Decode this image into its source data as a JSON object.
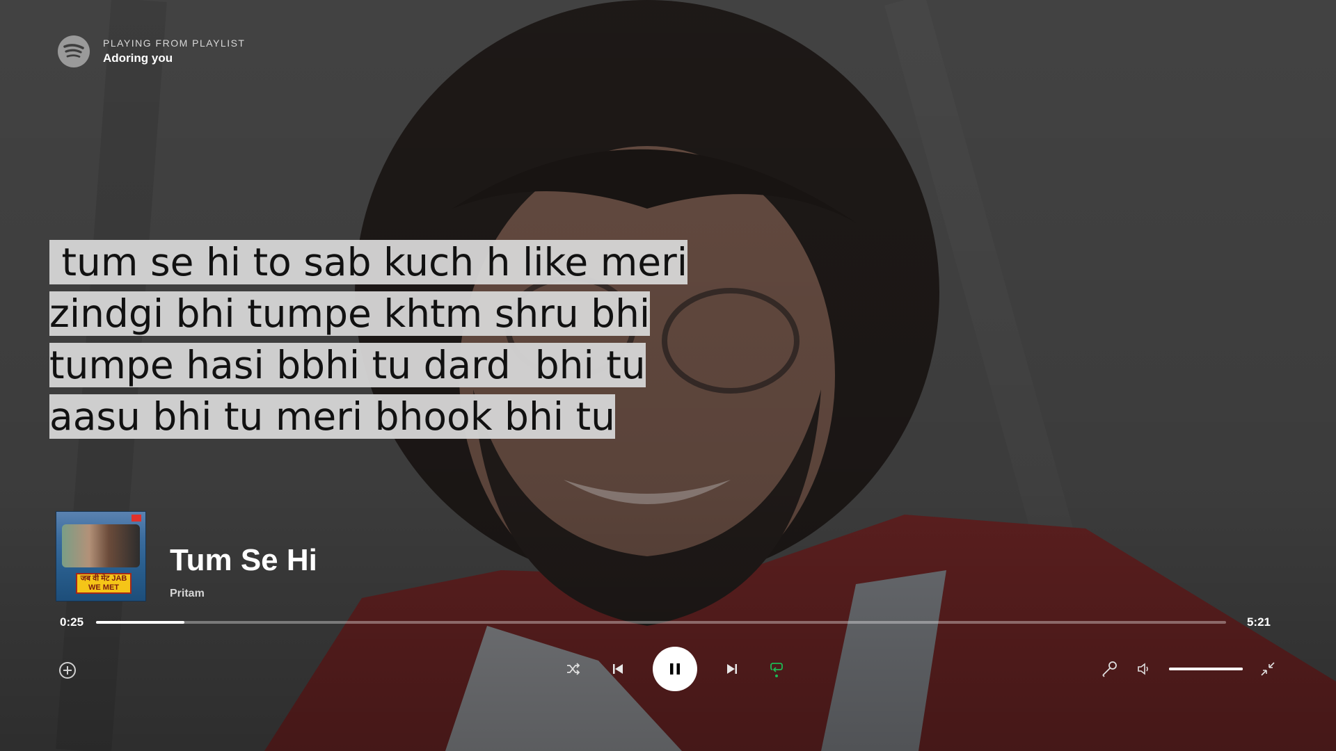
{
  "header": {
    "label": "PLAYING FROM PLAYLIST",
    "playlist": "Adoring you"
  },
  "lyrics": [
    " tum se hi to sab kuch h like meri",
    "zindgi bhi tumpe khtm shru bhi",
    "tumpe hasi bbhi tu dard  bhi tu",
    "aasu bhi tu meri bhook bhi tu"
  ],
  "track": {
    "title": "Tum Se Hi",
    "artist": "Pritam",
    "cover_text": "जब वी मेट JAB WE MET"
  },
  "progress": {
    "elapsed": "0:25",
    "duration": "5:21",
    "fraction": 0.078
  },
  "volume": {
    "fraction": 1.0
  },
  "colors": {
    "accent": "#1db954",
    "lyric_bg": "#d4d4d4",
    "lyric_text": "#111111"
  },
  "icons": {
    "logo": "spotify-logo-icon",
    "add": "plus-circle-icon",
    "shuffle": "shuffle-icon",
    "previous": "skip-back-icon",
    "pause": "pause-icon",
    "next": "skip-forward-icon",
    "repeat": "repeat-icon",
    "lyrics_mic": "microphone-icon",
    "volume": "volume-icon",
    "minimize": "minimize-icon"
  }
}
